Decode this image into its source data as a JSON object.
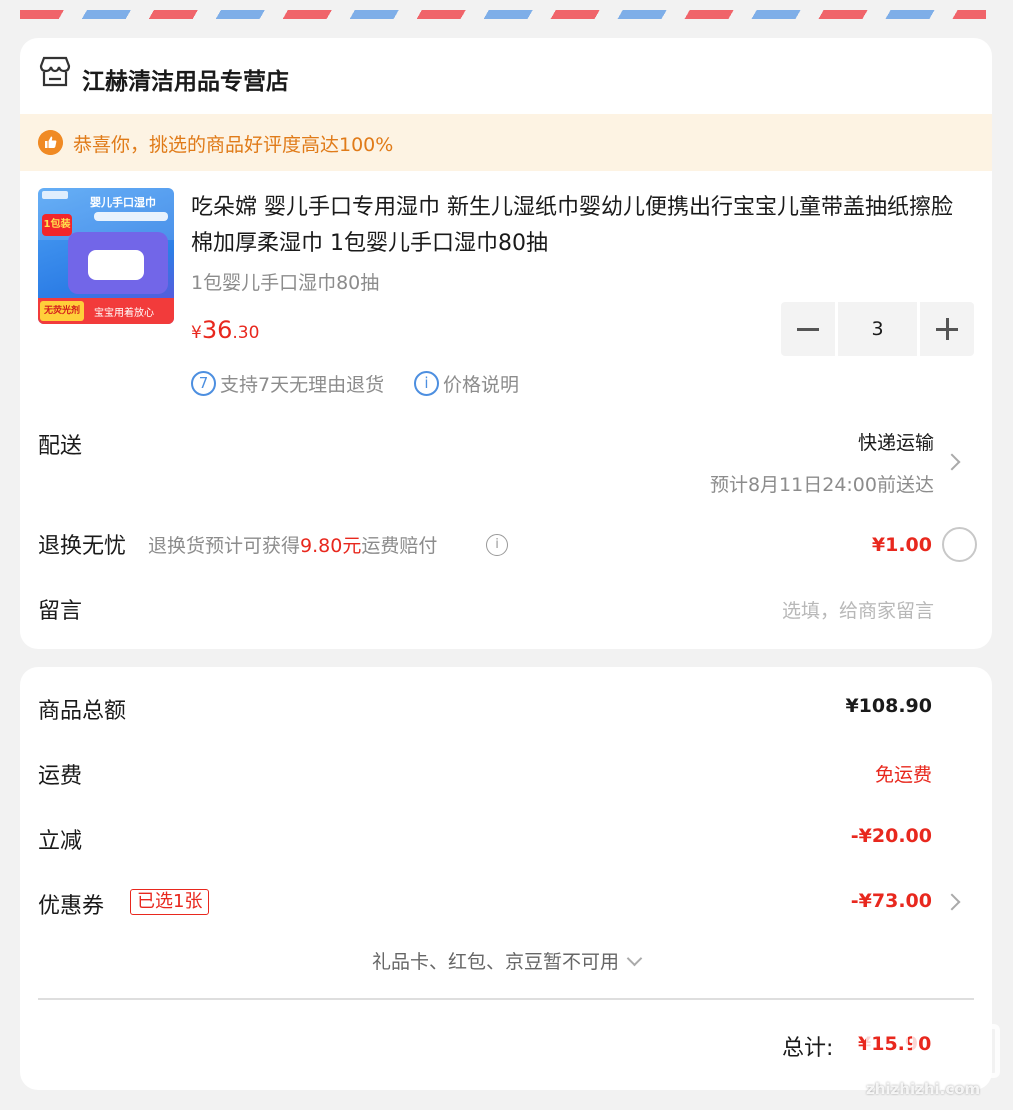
{
  "shop": {
    "name": "江赫清洁用品专营店"
  },
  "notice": {
    "text": "恭喜你，挑选的商品好评度高达100%"
  },
  "thumbnail": {
    "title": "婴儿手口湿巾",
    "badge": "1包装",
    "strip_left": "无荧光剂",
    "strip_right": "宝宝用着放心"
  },
  "product": {
    "title": "吃朵嫦 婴儿手口专用湿巾 新生儿湿纸巾婴幼儿便携出行宝宝儿童带盖抽纸擦脸棉加厚柔湿巾 1包婴儿手口湿巾80抽",
    "spec": "1包婴儿手口湿巾80抽",
    "price_currency": "¥",
    "price_int": "36",
    "price_dec": ".30",
    "quantity": "3"
  },
  "services": [
    {
      "icon_text": "7",
      "label": "支持7天无理由退货"
    },
    {
      "icon_text": "i",
      "label": "价格说明"
    }
  ],
  "delivery": {
    "label": "配送",
    "method": "快递运输",
    "eta": "预计8月11日24:00前送达"
  },
  "return_insurance": {
    "label": "退换无忧",
    "desc_prefix": "退换货预计可获得",
    "desc_amount": "9.80元",
    "desc_suffix": "运费赔付",
    "price": "¥1.00"
  },
  "memo": {
    "label": "留言",
    "placeholder": "选填，给商家留言"
  },
  "summary": {
    "goods_total_label": "商品总额",
    "goods_total": "¥108.90",
    "shipping_label": "运费",
    "shipping": "免运费",
    "discount_label": "立减",
    "discount": "-¥20.00",
    "coupon_label": "优惠券",
    "coupon_tag": "已选1张",
    "coupon": "-¥73.00",
    "giftcard_text": "礼品卡、红包、京豆暂不可用",
    "total_label": "总计:",
    "total": "¥15.90"
  },
  "watermark": {
    "text": "zhizhizhi.com"
  },
  "colors": {
    "accent_red": "#e8281e",
    "notice_orange": "#e07b19",
    "service_blue": "#4d8fe0"
  }
}
